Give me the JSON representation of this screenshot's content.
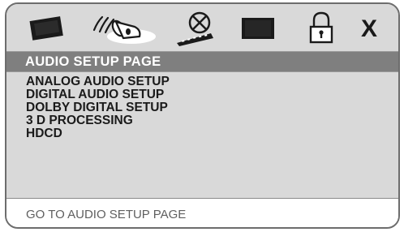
{
  "icons": [
    {
      "name": "tv-screen-icon",
      "active": false
    },
    {
      "name": "audio-speaker-icon",
      "active": true
    },
    {
      "name": "dolby-film-reel-icon",
      "active": false
    },
    {
      "name": "video-display-icon",
      "active": false
    },
    {
      "name": "padlock-icon",
      "active": false
    },
    {
      "name": "exit-icon",
      "active": false,
      "label": "X"
    }
  ],
  "header": {
    "title": "AUDIO SETUP PAGE"
  },
  "menu": {
    "items": [
      {
        "label": "ANALOG AUDIO SETUP"
      },
      {
        "label": "DIGITAL AUDIO SETUP"
      },
      {
        "label": "DOLBY DIGITAL SETUP"
      },
      {
        "label": "3 D PROCESSING"
      },
      {
        "label": "HDCD"
      }
    ]
  },
  "footer": {
    "status": "GO TO AUDIO SETUP PAGE"
  },
  "colors": {
    "panel": "#d9d9d9",
    "header": "#7f7f7f",
    "header_text": "#ffffff",
    "footer_text": "#5f5f5f",
    "icon_dark": "#1a1a1a",
    "border": "#6d6d6d"
  }
}
